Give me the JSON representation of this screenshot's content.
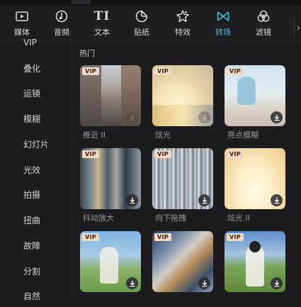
{
  "toolbar": {
    "items": [
      {
        "label": "媒体",
        "icon": "media-icon"
      },
      {
        "label": "音频",
        "icon": "audio-icon"
      },
      {
        "label": "文本",
        "icon": "text-icon",
        "glyph": "TI"
      },
      {
        "label": "贴纸",
        "icon": "sticker-icon"
      },
      {
        "label": "特效",
        "icon": "effects-icon"
      },
      {
        "label": "转场",
        "icon": "transition-icon",
        "active": true
      },
      {
        "label": "滤镜",
        "icon": "filter-icon"
      }
    ],
    "active_color": "#37c3d7"
  },
  "sidebar": {
    "items": [
      {
        "label": "VIP"
      },
      {
        "label": "叠化"
      },
      {
        "label": "运镜"
      },
      {
        "label": "模糊"
      },
      {
        "label": "幻灯片"
      },
      {
        "label": "光效"
      },
      {
        "label": "拍摄"
      },
      {
        "label": "扭曲"
      },
      {
        "label": "故障"
      },
      {
        "label": "分割"
      },
      {
        "label": "自然"
      }
    ]
  },
  "main": {
    "section_title": "热门",
    "badge": "VIP",
    "cards": [
      {
        "label": "推近 II",
        "vip": true
      },
      {
        "label": "炫光",
        "vip": true
      },
      {
        "label": "亮点模糊",
        "vip": true
      },
      {
        "label": "抖动放大",
        "vip": true
      },
      {
        "label": "向下拖拽",
        "vip": true
      },
      {
        "label": "炫光 II",
        "vip": true
      },
      {
        "label": "",
        "vip": true
      },
      {
        "label": "",
        "vip": true
      },
      {
        "label": "",
        "vip": true
      }
    ]
  }
}
